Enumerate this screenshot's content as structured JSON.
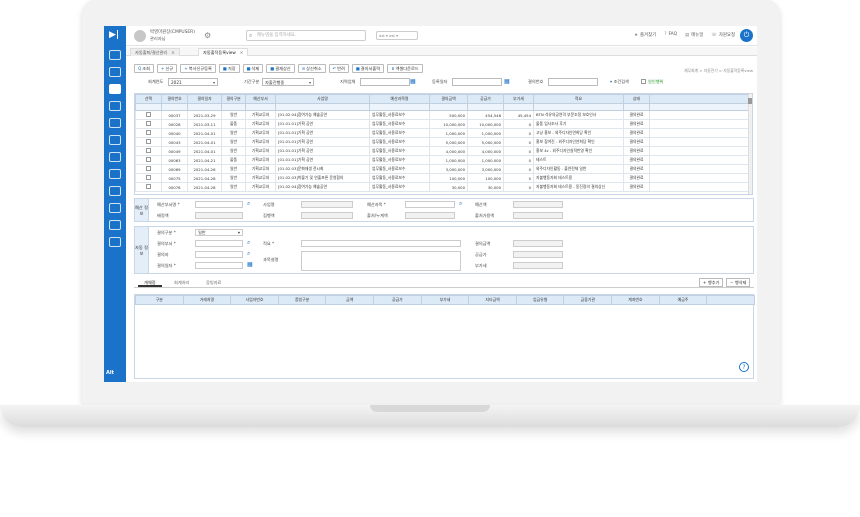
{
  "header": {
    "user_name": "박영미원장(CMPUSER)",
    "user_role": "관리자님",
    "search_placeholder": "메뉴명을 입력하세요.",
    "lang": "ast ▾ ast ▾",
    "links": [
      {
        "icon": "★",
        "label": "즐겨찾기"
      },
      {
        "icon": "?",
        "label": "FAQ"
      },
      {
        "icon": "▤",
        "label": "매뉴얼"
      },
      {
        "icon": "☏",
        "label": "자원요청"
      }
    ]
  },
  "tabs": [
    {
      "label": "자동출퇴/결산관리",
      "active": false
    },
    {
      "label": "자동출작등록view",
      "active": true
    }
  ],
  "breadcrumb": "재무회계 > 자동전기 > 자동출작등록view",
  "toolbar": [
    {
      "icon": "Q",
      "label": "조회"
    },
    {
      "icon": "+",
      "label": "신규"
    },
    {
      "icon": "+",
      "label": "복사신규등록"
    },
    {
      "icon": "■",
      "label": "저장"
    },
    {
      "icon": "■",
      "label": "삭제"
    },
    {
      "icon": "■",
      "label": "결재상신"
    },
    {
      "icon": "⊘",
      "label": "상신취소"
    },
    {
      "icon": "↶",
      "label": "반려"
    },
    {
      "icon": "■",
      "label": "결의서출력"
    },
    {
      "icon": "⬇",
      "label": "엑셀다운로드"
    }
  ],
  "filter": {
    "year_label": "회계연도",
    "year": "2021",
    "period_label": "기간구분",
    "period": "자출진행중",
    "company_label": "지역업체",
    "regdate_label": "등록일자",
    "appnum_label": "결의번호",
    "condition_label": "조건검색",
    "condition_check": "원인행위"
  },
  "grid": {
    "headers": [
      "선택",
      "결의번호",
      "결의일자",
      "결의구분",
      "예산부서",
      "사업명",
      "예산과목명",
      "결의금액",
      "공급가",
      "부가세",
      "적요",
      "상태"
    ],
    "rows": [
      [
        "",
        "00037",
        "2021-03-29",
        "일반",
        "기획교무처",
        "[01.02.04]참여가능 예술공연",
        "업무활동_사용료보수",
        "500,000",
        "454,546",
        "45,454",
        "BTN 석유의공연격 부문조정 보호인사",
        "결의완료"
      ],
      [
        "",
        "00028",
        "2021-03-11",
        "물품",
        "기획교무처",
        "[01.01.01]기획 공연",
        "업무활동_사용료보수",
        "10,000,000",
        "10,000,000",
        "0",
        "물품 입사조사 후기",
        "결의완료"
      ],
      [
        "",
        "00040",
        "2021-04-01",
        "일반",
        "기획교무처",
        "[01.01.01]기획 공연",
        "업무활동_사용료보수",
        "1,000,000",
        "1,000,000",
        "0",
        "고낭 홍보 - 외주디자인연희당 확인",
        "결의완료"
      ],
      [
        "",
        "00043",
        "2021-04-01",
        "일반",
        "기획교무처",
        "[01.01.01]기획 공연",
        "업무활동_사용료보수",
        "5,000,000",
        "5,000,000",
        "0",
        "홍보 참여진 - 외주디자인연희당 확인",
        "결의완료"
      ],
      [
        "",
        "00049",
        "2021-04-01",
        "일반",
        "기획교무처",
        "[01.01.01]기획 공연",
        "업무활동_사용료보수",
        "4,000,000",
        "4,000,000",
        "0",
        "홍보 4c - 외주디자인실적반영 확인",
        "결의완료"
      ],
      [
        "",
        "00063",
        "2021-04-21",
        "물품",
        "기획교무처",
        "[01.01.01]기획 공연",
        "업무활동_사용료보수",
        "1,000,000",
        "1,000,000",
        "0",
        "테스트",
        "결의완료"
      ],
      [
        "",
        "00069",
        "2021-04-26",
        "일반",
        "기획교무처",
        "[01.02.03]문화재생 전시회",
        "업무활동_사용료보수",
        "3,000,000",
        "3,000,000",
        "0",
        "외주디자인활동 - 출연전체 일반",
        "결의완료"
      ],
      [
        "",
        "00075",
        "2021-04-28",
        "일반",
        "기획교무처",
        "[01.02.03]박물기 및 연출포론 운영협의",
        "업무활동_사용료보수",
        "100,000",
        "100,000",
        "0",
        "지불행동자회 테스트용",
        "결의완료"
      ],
      [
        "",
        "00076",
        "2021-04-28",
        "일반",
        "기획교무처",
        "[01.02.04]참여가능 예술공연",
        "업무활동_사용료보수",
        "30,000",
        "30,000",
        "0",
        "지불행동자회 테스트용 - 동진정의 결의상신",
        "결의완료"
      ]
    ]
  },
  "budget_section": {
    "title": "예산 정보",
    "fields": [
      "예산부서명 *",
      "사업명",
      "예산과목 *",
      "예산액",
      "배정액",
      "집행액",
      "출처/누계액",
      "출처가용액"
    ]
  },
  "resolution_section": {
    "title": "자동 정보",
    "fields": [
      "결의구분 *",
      "결의부서 *",
      "결의자",
      "결의일자 *",
      "적요 *",
      "과목설명",
      "결의금액",
      "공급가",
      "부가세"
    ],
    "type_value": "일반"
  },
  "bottom_tabs": [
    "개체정",
    "회계처리",
    "증빙자료"
  ],
  "bottom_buttons": [
    "+ 행추가",
    "− 행삭제"
  ],
  "bottom_headers": [
    "구분",
    "거래처명",
    "사업자번호",
    "증빙구분",
    "금액",
    "공급가",
    "부가세",
    "지타금액",
    "업금유형",
    "금융기관",
    "계좌번호",
    "예금주"
  ],
  "sidebar_footer": "Alt"
}
